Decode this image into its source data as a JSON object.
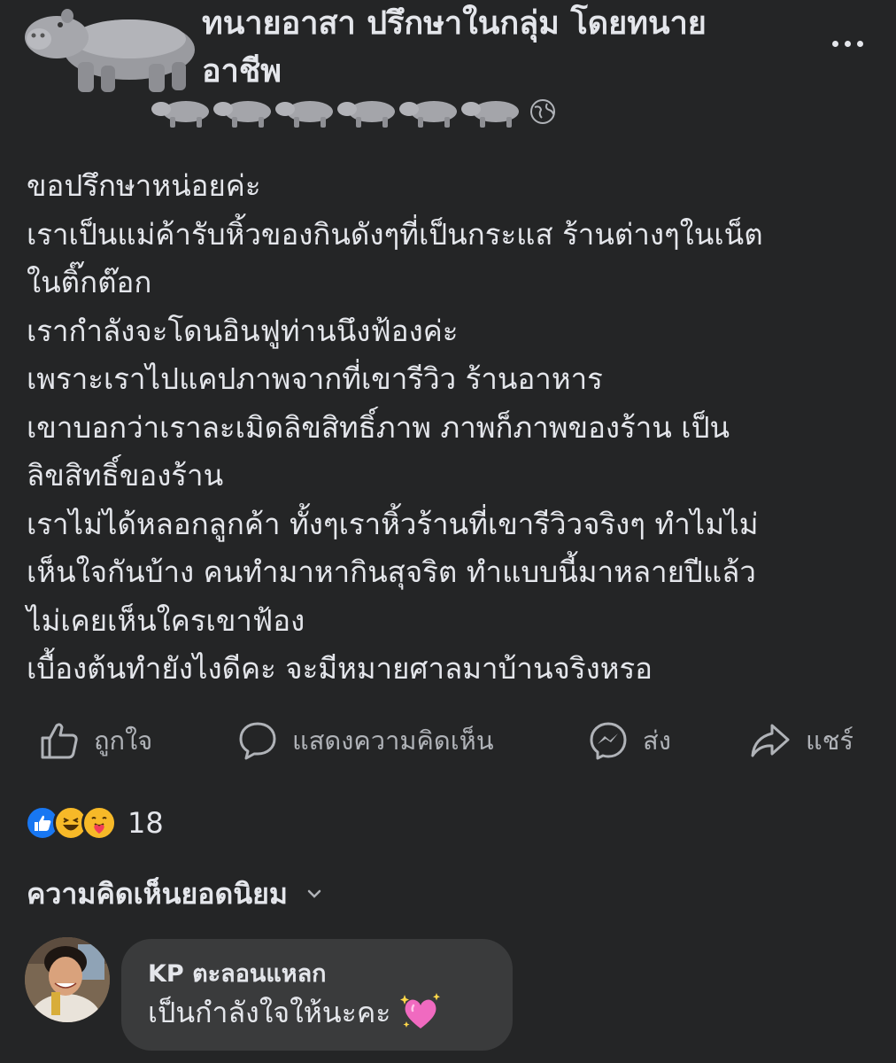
{
  "post": {
    "title": "ทนายอาสา ปรึกษาในกลุ่ม โดยทนายอาชีพ",
    "title_line1": "ทนายอาสา ปรึกษาในกลุ่ม โดยทนาย",
    "title_line2": "อาชีพ",
    "body_lines": [
      "ขอปรึกษาหน่อยค่ะ",
      "เราเป็นแม่ค้ารับหิ้วของกินดังๆที่เป็นกระแส ร้านต่างๆในเน็ต",
      "ในติ๊กต๊อก",
      "เรากำลังจะโดนอินฟูท่านนึงฟ้องค่ะ",
      "เพราะเราไปแคปภาพจากที่เขารีวิว ร้านอาหาร",
      "เขาบอกว่าเราละเมิดลิขสิทธิ์ภาพ ภาพก็ภาพของร้าน เป็น",
      "ลิขสิทธิ์ของร้าน",
      "เราไม่ได้หลอกลูกค้า ทั้งๆเราหิ้วร้านที่เขารีวิวจริงๆ ทำไมไม่",
      "เห็นใจกันบ้าง คนทำมาหากินสุจริต ทำแบบนี้มาหลายปีแล้ว",
      "ไม่เคยเห็นใครเขาฟ้อง",
      "เบื้องต้นทำยังไงดีคะ จะมีหมายศาลมาบ้านจริงหรอ"
    ]
  },
  "actions": {
    "like": "ถูกใจ",
    "comment": "แสดงความคิดเห็น",
    "send": "ส่ง",
    "share": "แชร์"
  },
  "reactions": {
    "icons": [
      "like-reaction",
      "haha-reaction",
      "care-reaction"
    ],
    "count": "18"
  },
  "comments_section": {
    "sort_label": "ความคิดเห็นยอดนิยม"
  },
  "comment": {
    "author": "KP ตะลอนแหลก",
    "text": "เป็นกำลังใจให้นะคะ"
  },
  "colors": {
    "background": "#242526",
    "text_primary": "#e4e6eb",
    "text_secondary": "#b0b3b8",
    "bubble": "#3a3b3c",
    "like_blue": "#1877f2",
    "emoji_yellow": "#f7b928"
  }
}
